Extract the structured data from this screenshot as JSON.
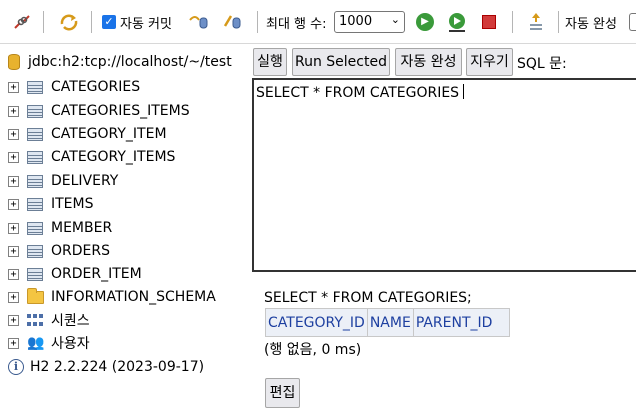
{
  "toolbar": {
    "autocommit_label": "자동 커밋",
    "maxrows_label": "최대 행 수:",
    "maxrows_value": "1000",
    "autocomplete_label": "자동 완성"
  },
  "tree": {
    "connection": "jdbc:h2:tcp://localhost/~/test",
    "expander": "+",
    "items": [
      {
        "label": "CATEGORIES"
      },
      {
        "label": "CATEGORIES_ITEMS"
      },
      {
        "label": "CATEGORY_ITEM"
      },
      {
        "label": "CATEGORY_ITEMS"
      },
      {
        "label": "DELIVERY"
      },
      {
        "label": "ITEMS"
      },
      {
        "label": "MEMBER"
      },
      {
        "label": "ORDERS"
      },
      {
        "label": "ORDER_ITEM"
      }
    ],
    "schema": "INFORMATION_SCHEMA",
    "sequences": "시퀀스",
    "users": "사용자",
    "version": "H2 2.2.224 (2023-09-17)"
  },
  "query_buttons": {
    "run": "실행",
    "run_selected": "Run Selected",
    "autocomplete": "자동 완성",
    "clear": "지우기",
    "sql_label": "SQL 문:"
  },
  "editor": {
    "text": "SELECT * FROM CATEGORIES"
  },
  "result": {
    "query": "SELECT * FROM CATEGORIES;",
    "columns": [
      "CATEGORY_ID",
      "NAME",
      "PARENT_ID"
    ],
    "status": "(행 없음, 0 ms)",
    "edit_button": "편집"
  },
  "colors": {
    "header_bg": "#ecf0f7",
    "header_text": "#1d3fa0",
    "run_green": "#3a9a3a",
    "stop_red": "#d23b3b"
  }
}
